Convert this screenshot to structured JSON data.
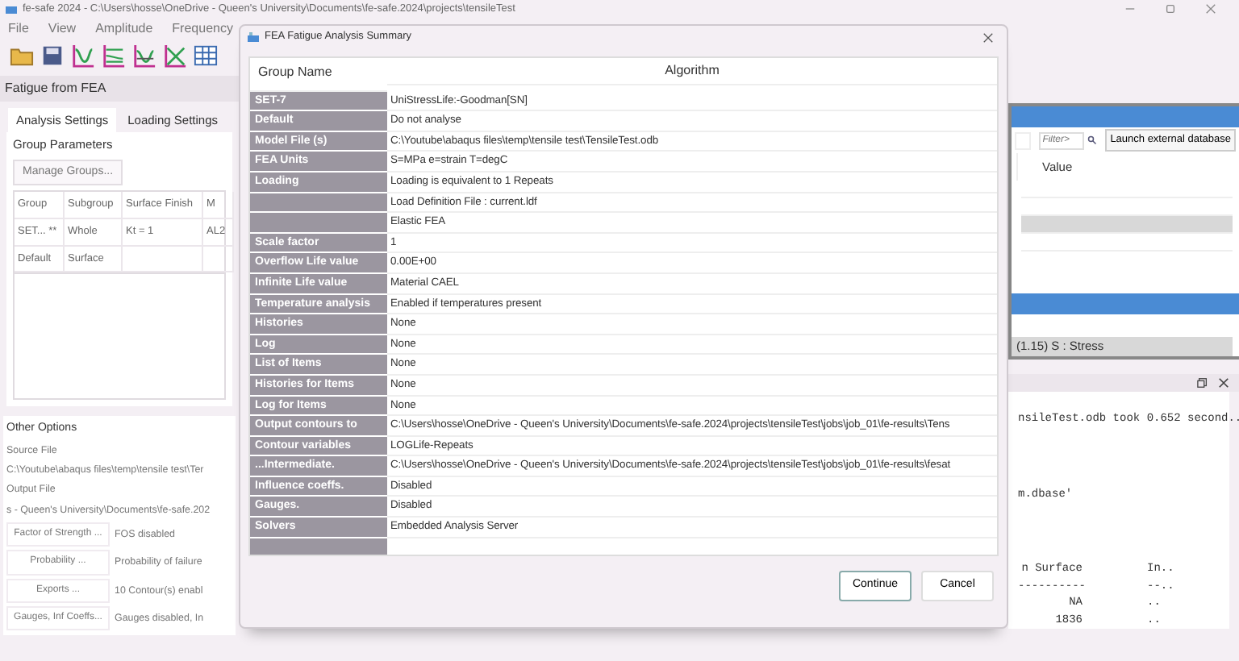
{
  "window": {
    "title": "fe-safe 2024 - C:\\Users\\hosse\\OneDrive - Queen's University\\Documents\\fe-safe.2024\\projects\\tensileTest"
  },
  "menu": [
    "File",
    "View",
    "Amplitude",
    "Frequency"
  ],
  "left_panel": {
    "title": "Fatigue from FEA",
    "tabs": [
      {
        "label": "Analysis Settings",
        "selected": true
      },
      {
        "label": "Loading Settings",
        "selected": false
      }
    ],
    "group_parameters": {
      "heading": "Group Parameters",
      "manage_button": "Manage Groups...",
      "columns": [
        "Group",
        "Subgroup",
        "Surface Finish",
        "M"
      ],
      "rows": [
        [
          "SET... **",
          "Whole",
          "Kt = 1",
          "AL2"
        ],
        [
          "Default",
          "Surface"
        ]
      ]
    },
    "other_options": {
      "heading": "Other Options",
      "source_label": "Source File",
      "source_value": "C:\\Youtube\\abaqus files\\temp\\tensile test\\Ter",
      "output_label": "Output File",
      "output_value": "s - Queen's University\\Documents\\fe-safe.202",
      "settings": [
        {
          "button": "Factor of Strength ...",
          "value": "FOS disabled"
        },
        {
          "button": "Probability ...",
          "value": "Probability of failure"
        },
        {
          "button": "Exports ...",
          "value": "10 Contour(s) enabl"
        },
        {
          "button": "Gauges, Inf Coeffs...",
          "value": "Gauges disabled, In"
        }
      ]
    }
  },
  "right_panel": {
    "filter": {
      "placeholder": "Filter>"
    },
    "launch_button": "Launch external database",
    "columns": [
      "Value"
    ],
    "material_rows": [
      {
        "selected": false
      },
      {
        "selected": false
      },
      {
        "selected": true
      },
      {
        "selected": false
      }
    ],
    "dataset_rows": [
      {
        "text": "(1.15) S : Stress",
        "selected": true
      }
    ]
  },
  "log": {
    "lines": [
      [
        "nsileTest.odb took 0.652 second.."
      ],
      [
        "m.dbase'"
      ],
      [
        "n Surface",
        "In.."
      ],
      [
        "----------",
        "--.."
      ],
      [
        "NA",
        ".."
      ],
      [
        "1836",
        ".."
      ]
    ]
  },
  "dialog": {
    "title": "FEA Fatigue Analysis Summary",
    "columns": [
      "Group Name",
      "Algorithm"
    ],
    "rows": [
      {
        "name": "SET-7",
        "value": "UniStressLife:-Goodman[SN]"
      },
      {
        "name": "Default",
        "value": "Do not analyse"
      },
      {
        "name": "Model File (s)",
        "value": "C:\\Youtube\\abaqus files\\temp\\tensile test\\TensileTest.odb"
      },
      {
        "name": "FEA Units",
        "value": "S=MPa e=strain T=degC"
      },
      {
        "name": "Loading",
        "value": "Loading is equivalent to 1 Repeats"
      },
      {
        "value": "Load Definition File : current.ldf"
      },
      {
        "value": "Elastic FEA"
      },
      {
        "name": "Scale factor",
        "value": "1"
      },
      {
        "name": "Overflow Life value",
        "value": "0.00E+00"
      },
      {
        "name": "Infinite Life value",
        "value": "Material CAEL"
      },
      {
        "name": "Temperature analysis",
        "value": "Enabled if temperatures present"
      },
      {
        "name": "Histories",
        "value": "None"
      },
      {
        "name": "Log",
        "value": "None"
      },
      {
        "name": "List of Items",
        "value": "None"
      },
      {
        "name": "Histories for Items",
        "value": "None"
      },
      {
        "name": "Log for Items",
        "value": "None"
      },
      {
        "name": "Output contours to",
        "value": "C:\\Users\\hosse\\OneDrive - Queen's University\\Documents\\fe-safe.2024\\projects\\tensileTest\\jobs\\job_01\\fe-results\\Tens"
      },
      {
        "name": "Contour variables",
        "value": "LOGLife-Repeats"
      },
      {
        "name": "...Intermediate.",
        "value": "C:\\Users\\hosse\\OneDrive - Queen's University\\Documents\\fe-safe.2024\\projects\\tensileTest\\jobs\\job_01\\fe-results\\fesat"
      },
      {
        "name": "Influence coeffs.",
        "value": "Disabled"
      },
      {
        "name": "Gauges.",
        "value": "Disabled"
      },
      {
        "name": "Solvers",
        "value": "Embedded Analysis Server"
      }
    ],
    "buttons": [
      {
        "label": "Continue",
        "default": true
      },
      {
        "label": "Cancel",
        "default": false
      }
    ]
  }
}
